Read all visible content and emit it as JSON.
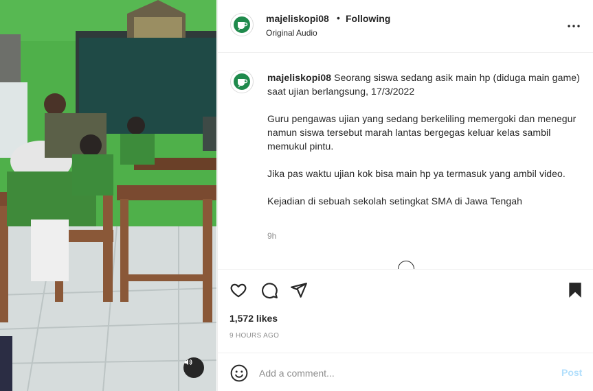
{
  "media": {
    "image_alt": "video thumbnail",
    "audio_icon": "speaker-icon"
  },
  "header": {
    "username": "majeliskopi08",
    "dot": "•",
    "follow_label": "Following",
    "audio_label": "Original Audio",
    "more_icon": "more-horizontal-icon"
  },
  "caption": {
    "username": "majeliskopi08",
    "paragraphs": [
      "Seorang siswa sedang asik main hp (diduga main game) saat ujian berlangsung, 17/3/2022",
      "Guru pengawas ujian yang sedang berkeliling memergoki dan menegur namun siswa tersebut marah lantas bergegas keluar kelas sambil memukul pintu.",
      "Jika pas waktu ujian kok bisa main hp ya termasuk yang ambil video.",
      "Kejadian di sebuah sekolah setingkat SMA di Jawa Tengah"
    ],
    "time": "9h"
  },
  "actions": {
    "like_icon": "heart-icon",
    "comment_icon": "comment-icon",
    "share_icon": "paper-plane-icon",
    "save_icon": "bookmark-icon",
    "likes": "1,572 likes",
    "ago": "9 HOURS AGO"
  },
  "comment": {
    "emoji_icon": "emoji-icon",
    "placeholder": "Add a comment...",
    "post_label": "Post"
  },
  "colors": {
    "post_disabled": "#b2dffc",
    "muted": "#8e8e8e",
    "text": "#262626",
    "logo_green": "#1f8a4c"
  }
}
